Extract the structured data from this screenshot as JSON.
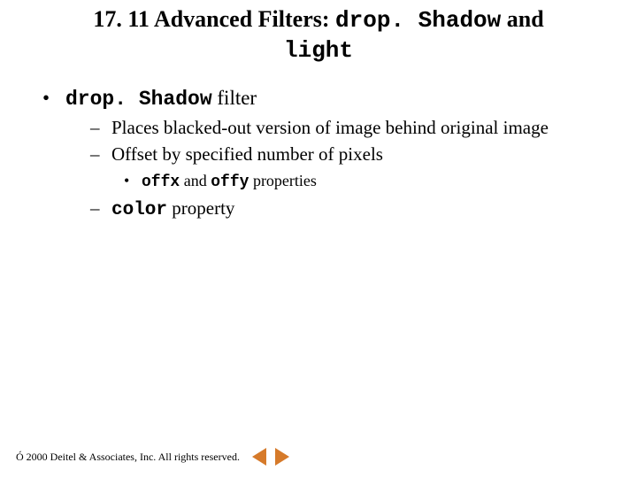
{
  "title": {
    "prefix": "17. 11 Advanced Filters: ",
    "code1": "drop. Shadow",
    "mid": " and ",
    "code2": "light"
  },
  "bullets": {
    "l1": {
      "code": "drop. Shadow",
      "rest": " filter"
    },
    "l2a": "Places blacked-out version of image behind original image",
    "l2b": "Offset by specified number of pixels",
    "l3": {
      "code1": "offx",
      "mid": " and ",
      "code2": "offy",
      "rest": " properties"
    },
    "l2c": {
      "code": "color",
      "rest": " property"
    }
  },
  "footer": {
    "copyright": "Ó 2000 Deitel & Associates, Inc.  All rights reserved."
  }
}
